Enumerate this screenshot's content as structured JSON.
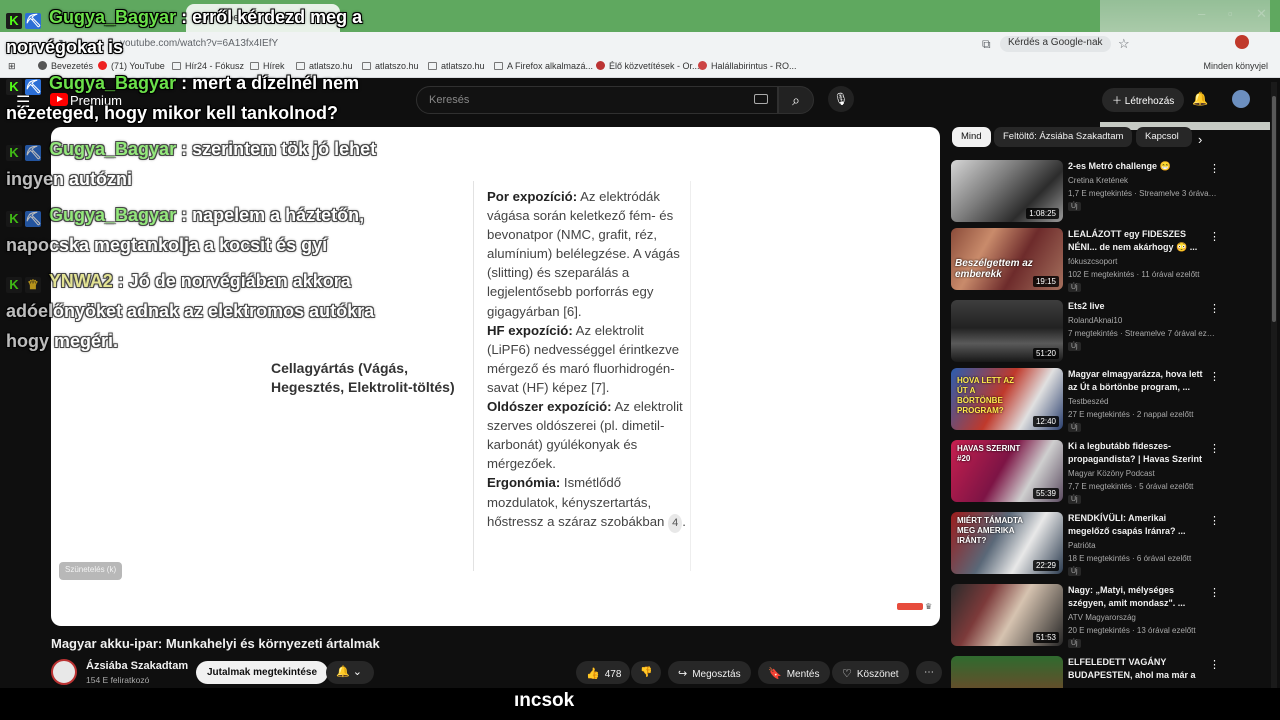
{
  "browser": {
    "tab_title": "YouTube",
    "url": "youtube.com/watch?v=6A13fx4IEfY",
    "google_search_label": "Kérdés a Google-nak",
    "bookmarks": [
      "Bevezetés",
      "(71) YouTube",
      "Hír24 - Fókusz",
      "Hírek",
      "atlatszo.hu",
      "atlatszo.hu",
      "atlatszo.hu",
      "A Firefox alkalmazá...",
      "Élő közvetítések - Or...",
      "Halállabirintus - RO..."
    ],
    "other_bookmarks": "Minden könyvjel"
  },
  "youtube": {
    "premium_label": "Premium",
    "search_placeholder": "Keresés",
    "create_label": "Létrehozás"
  },
  "chat": [
    {
      "user": "Gugya_Bagyar",
      "lines": [
        " : erről kérdezd meg a",
        "norvégokat is"
      ],
      "badge": "pipe"
    },
    {
      "user": "Gugya_Bagyar",
      "lines": [
        " : mert a dízelnél nem",
        "nézeteged, hogy mikor kell tankolnod?"
      ],
      "badge": "pipe"
    },
    {
      "user": "Gugya_Bagyar",
      "lines": [
        " : szerintem tök jó lehet",
        "ingyen autózni"
      ],
      "badge": "pipe"
    },
    {
      "user": "Gugya_Bagyar",
      "lines": [
        " : napelem a háztetőn,",
        "napocska megtankolja a kocsit és gyí"
      ],
      "badge": "pipe"
    },
    {
      "user": "YNWA2",
      "lines": [
        " : Jó de norvégiában akkora",
        "adóelőnyöket adnak az elektromos autókra",
        "hogy megéri."
      ],
      "badge": "crown"
    }
  ],
  "slide": {
    "left_heading": "Cellagyártás (Vágás, Hegesztés, Elektrolit-töltés)",
    "items": [
      {
        "term": "Por expozíció:",
        "text": " Az elektródák vágása során keletkező fém- és bevonatpor (NMC, grafit, réz, alumínium) belélegzése. A vágás (slitting) és szeparálás a legjelentősebb porforrás egy gigagyárban [6]."
      },
      {
        "term": "HF expozíció:",
        "text": " Az elektrolit (LiPF6) nedvességgel érintkezve mérgező és maró fluorhidrogén-savat (HF) képez [7]."
      },
      {
        "term": "Oldószer expozíció:",
        "text": " Az elektrolit szerves oldószerei (pl. dimetil-karbonát) gyúlékonyak és mérgezőek."
      },
      {
        "term": "Ergonómia:",
        "text": " Ismétlődő mozdulatok, kényszertartás, hőstressz a száraz szobákban"
      }
    ],
    "ref_badge": "4",
    "end_period": ".",
    "overlay_label": "Szünetelés (k)"
  },
  "video": {
    "title": "Magyar akku-ipar: Munkahelyi és környezeti ártalmak",
    "channel": "Ázsiába Szakadtam",
    "subs": "154 E feliratkozó",
    "join_label": "Jutalmak megtekintése",
    "like_count": "478",
    "share_label": "Megosztás",
    "save_label": "Mentés",
    "thanks_label": "Köszönet"
  },
  "bottom_subtitle": "ıncsok",
  "chips": [
    "Mind",
    "Feltöltő: Ázsiába Szakadtam",
    "Kapcsol"
  ],
  "recommendations": [
    {
      "title": "2-es Metró challenge 😁",
      "channel": "Cretina Kretének",
      "meta": "1,7 E megtekintés · Streamelve 3 órával ...",
      "duration": "1:08:25",
      "badge": "Új",
      "thumb_class": "t1",
      "caption": ""
    },
    {
      "title": "LEALÁZOTT egy FIDESZES NÉNI... de nem akárhogy 😳 ...",
      "channel": "fókuszcsoport",
      "meta": "102 E megtekintés · 11 órával ezelőtt",
      "duration": "19:15",
      "badge": "Új",
      "thumb_class": "t2",
      "caption": "Beszélgettem az emberekk"
    },
    {
      "title": "Ets2 live",
      "channel": "RolandAknai10",
      "meta": "7 megtekintés · Streamelve 7 órával ezel...",
      "duration": "51:20",
      "badge": "Új",
      "thumb_class": "t3",
      "caption": ""
    },
    {
      "title": "Magyar elmagyarázza, hova lett az Út a börtönbe program, ...",
      "channel": "Testbeszéd",
      "meta": "27 E megtekintés · 2 nappal ezelőtt",
      "duration": "12:40",
      "badge": "Új",
      "thumb_class": "t4",
      "caption": "HOVA LETT AZ ÚT A BÖRTÖNBE PROGRAM?"
    },
    {
      "title": "Ki a legbutább fideszes-propagandista? | Havas Szerint",
      "channel": "Magyar Közöny Podcast",
      "meta": "7,7 E megtekintés · 5 órával ezelőtt",
      "duration": "55:39",
      "badge": "Új",
      "thumb_class": "t5",
      "caption": "HAVAS SZERINT #20"
    },
    {
      "title": "RENDKÍVÜLI: Amerikai megelőző csapás Iránra? ...",
      "channel": "Patrióta",
      "meta": "18 E megtekintés · 6 órával ezelőtt",
      "duration": "22:29",
      "badge": "Új",
      "thumb_class": "t6",
      "caption": "MIÉRT TÁMADTA MEG AMERIKA IRÁNT?"
    },
    {
      "title": "Nagy: „Matyi, mélységes szégyen, amit mondasz\". ...",
      "channel": "ATV Magyarország",
      "meta": "20 E megtekintés · 13 órával ezelőtt",
      "duration": "51:53",
      "badge": "Új",
      "thumb_class": "t7",
      "caption": ""
    },
    {
      "title": "ELFELEDETT VAGÁNY BUDAPESTEN, ahol ma már a ...",
      "channel": "",
      "meta": "",
      "duration": "",
      "badge": "",
      "thumb_class": "t8",
      "caption": ""
    }
  ],
  "colors": {
    "accent": "#ff0000",
    "kick_green": "#53fc18",
    "username_green": "#6be04a",
    "background": "#0f0f0f"
  }
}
